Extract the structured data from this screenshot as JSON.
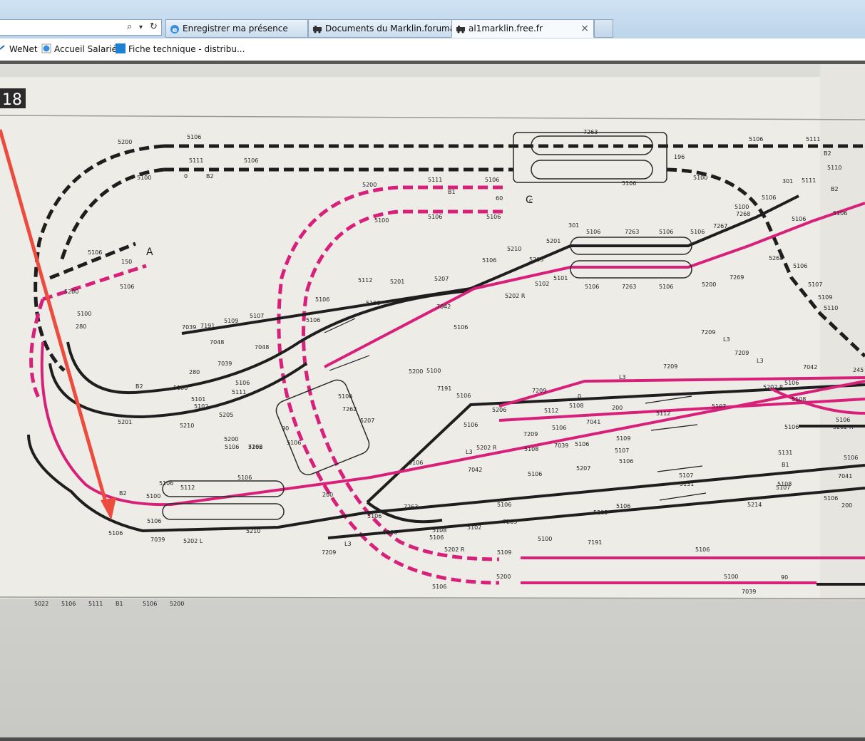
{
  "browser": {
    "address_icons": {
      "search": "⌕",
      "dropdown": "▾",
      "refresh": "↻"
    },
    "tabs": [
      {
        "label": "Enregistrer ma présence",
        "icon": "ie-icon"
      },
      {
        "label": "Documents du Marklin.foruma...",
        "icon": "train-icon"
      },
      {
        "label": "al1marklin.free.fr",
        "icon": "train-icon",
        "active": true
      }
    ],
    "close_glyph": "×",
    "favorites": [
      {
        "label": "WeNet",
        "icon": "link-icon"
      },
      {
        "label": "Accueil Salarié",
        "icon": "ie-icon"
      },
      {
        "label": "Fiche technique - distribu...",
        "icon": "blue-square-icon"
      }
    ]
  },
  "colors": {
    "pink": "#d8207a",
    "black": "#1e1e1e",
    "arrow": "#ee4b3f",
    "paper": "#ecebe6"
  },
  "plan": {
    "number": "18",
    "letters": {
      "a": "A",
      "c": "C"
    },
    "labels": [
      "5200",
      "5106",
      "5111",
      "5106",
      "B2",
      "5100",
      "0",
      "7263",
      "5106",
      "196",
      "5100",
      "5111",
      "B2",
      "5110",
      "5106",
      "5106",
      "301",
      "5111",
      "B2",
      "5106",
      "5200",
      "5111",
      "B1",
      "5106",
      "60",
      "C",
      "5106",
      "5106",
      "5100",
      "5100",
      "7268",
      "5106",
      "7267",
      "5106",
      "7263",
      "5106",
      "301",
      "5106",
      "5210",
      "5201",
      "5205",
      "5106",
      "5268",
      "5106",
      "5106",
      "150",
      "5106",
      "5200",
      "5100",
      "280",
      "5112",
      "5201",
      "5207",
      "5202 R",
      "5102",
      "5101",
      "5106",
      "7263",
      "5106",
      "5200",
      "7269",
      "5107",
      "5109",
      "5110",
      "5106",
      "7042",
      "5106",
      "7039",
      "7191",
      "5109",
      "5107",
      "5106",
      "7048",
      "7048",
      "5200",
      "5100",
      "7209",
      "L3",
      "7209",
      "L3",
      "7042",
      "245",
      "5106",
      "280",
      "7039",
      "5106",
      "5111",
      "B2",
      "5100",
      "5101",
      "5102",
      "5205",
      "5210",
      "5201",
      "5200",
      "5106",
      "7209",
      "L3",
      "7191",
      "5106",
      "7209",
      "0",
      "5206",
      "5112",
      "5108",
      "7041",
      "200",
      "5112",
      "5107",
      "5106",
      "5106",
      "5202 R",
      "5106",
      "5108",
      "5106",
      "5202 R",
      "5106",
      "5207",
      "7262",
      "90",
      "5106",
      "5106",
      "7262",
      "5106",
      "7209",
      "L3",
      "5202 R",
      "5108",
      "7039",
      "5106",
      "5109",
      "5107",
      "5131",
      "B1",
      "5106",
      "7041",
      "5106",
      "7042",
      "5106",
      "5207",
      "5106",
      "5107",
      "5131",
      "B2",
      "5106",
      "5112",
      "5106",
      "5100",
      "200",
      "5106",
      "7263",
      "5102",
      "5106",
      "5214",
      "5108",
      "5107",
      "5106",
      "7039",
      "5202 L",
      "5210",
      "5205",
      "5106",
      "7263",
      "5106",
      "200",
      "5106",
      "5108",
      "5106",
      "7209",
      "L3",
      "5200",
      "5202 R",
      "5100",
      "7191",
      "5109",
      "5106",
      "5200",
      "5100",
      "7039",
      "90",
      "5106",
      "5022",
      "5106",
      "5111",
      "B1",
      "5106",
      "5200"
    ]
  }
}
